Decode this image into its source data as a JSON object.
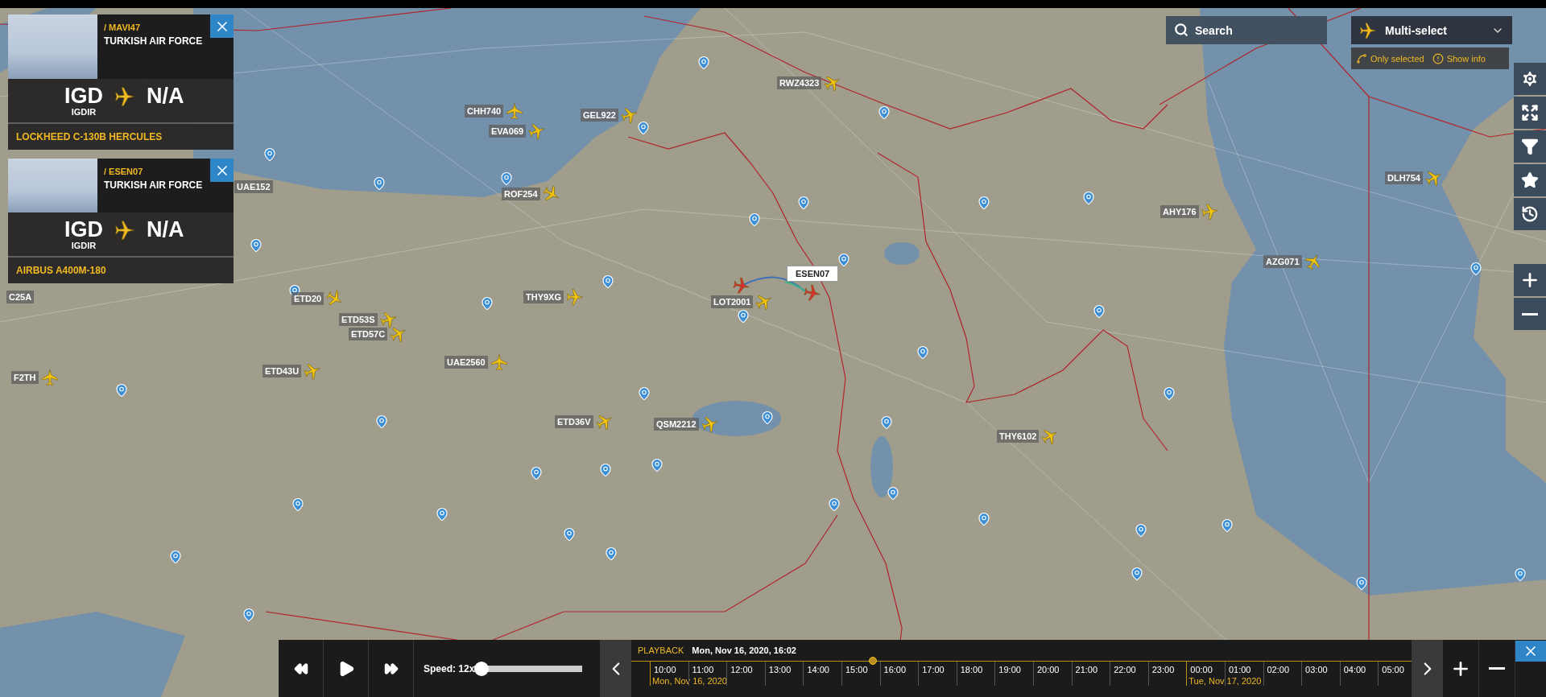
{
  "flight_cards": [
    {
      "callsign": "/ MAVI47",
      "airline": "TURKISH AIR FORCE",
      "origin_code": "IGD",
      "origin_name": "IGDIR",
      "destination_code": "N/A",
      "aircraft": "LOCKHEED C-130B HERCULES"
    },
    {
      "callsign": "/ ESEN07",
      "airline": "TURKISH AIR FORCE",
      "origin_code": "IGD",
      "origin_name": "IGDIR",
      "destination_code": "N/A",
      "aircraft": "AIRBUS A400M-180"
    }
  ],
  "search": {
    "placeholder": "Search"
  },
  "multi_select": {
    "label": "Multi-select",
    "options": [
      {
        "label": "Only selected"
      },
      {
        "label": "Show info"
      }
    ]
  },
  "map": {
    "flights": [
      {
        "callsign": "CHH740",
        "selected": false
      },
      {
        "callsign": "EVA069",
        "selected": false
      },
      {
        "callsign": "GEL922",
        "selected": false
      },
      {
        "callsign": "RWZ4323",
        "selected": false
      },
      {
        "callsign": "ROF254",
        "selected": false
      },
      {
        "callsign": "UAE152",
        "selected": false
      },
      {
        "callsign": "C25A",
        "selected": false
      },
      {
        "callsign": "F2TH",
        "selected": false
      },
      {
        "callsign": "ETD20",
        "selected": false
      },
      {
        "callsign": "ETD53S",
        "selected": false
      },
      {
        "callsign": "ETD57C",
        "selected": false
      },
      {
        "callsign": "THY9XG",
        "selected": false
      },
      {
        "callsign": "LOT2001",
        "selected": false
      },
      {
        "callsign": "UAE2560",
        "selected": false
      },
      {
        "callsign": "ETD43U",
        "selected": false
      },
      {
        "callsign": "ETD36V",
        "selected": false
      },
      {
        "callsign": "QSM2212",
        "selected": false
      },
      {
        "callsign": "THY6102",
        "selected": false
      },
      {
        "callsign": "AHY176",
        "selected": false
      },
      {
        "callsign": "AZG071",
        "selected": false
      },
      {
        "callsign": "DLH754",
        "selected": false
      },
      {
        "callsign": "ESEN07",
        "selected": true
      }
    ]
  },
  "playback": {
    "speed_label": "Speed: 12x",
    "speed": {
      "level": 0
    }
  },
  "timeline": {
    "title": "PLAYBACK",
    "current_time": "Mon, Nov 16, 2020, 16:02",
    "cursor": {
      "level": 0.31
    },
    "ticks": [
      {
        "label": "10:00",
        "date": "Mon, Nov 16, 2020"
      },
      {
        "label": "11:00"
      },
      {
        "label": "12:00"
      },
      {
        "label": "13:00"
      },
      {
        "label": "14:00"
      },
      {
        "label": "15:00"
      },
      {
        "label": "16:00"
      },
      {
        "label": "17:00"
      },
      {
        "label": "18:00"
      },
      {
        "label": "19:00"
      },
      {
        "label": "20:00"
      },
      {
        "label": "21:00"
      },
      {
        "label": "22:00"
      },
      {
        "label": "23:00"
      },
      {
        "label": "00:00",
        "date": "Tue, Nov 17, 2020"
      },
      {
        "label": "01:00"
      },
      {
        "label": "02:00"
      },
      {
        "label": "03:00"
      },
      {
        "label": "04:00"
      },
      {
        "label": "05:00"
      }
    ]
  }
}
